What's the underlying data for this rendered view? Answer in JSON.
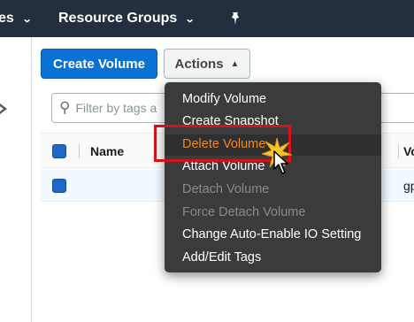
{
  "topnav": {
    "services_label": "es",
    "resource_groups_label": "Resource Groups",
    "pin_icon": "pin-icon"
  },
  "toolbar": {
    "create_label": "Create Volume",
    "actions_label": "Actions"
  },
  "filter": {
    "placeholder": "Filter by tags a"
  },
  "table": {
    "columns": [
      "Name",
      "Vo"
    ],
    "rows": [
      {
        "name": "",
        "volume_type": "gp"
      }
    ]
  },
  "menu": {
    "items": [
      {
        "label": "Modify Volume",
        "enabled": true
      },
      {
        "label": "Create Snapshot",
        "enabled": true
      },
      {
        "label": "Delete Volume",
        "enabled": true,
        "highlighted": true
      },
      {
        "label": "Attach Volume",
        "enabled": true
      },
      {
        "label": "Detach Volume",
        "enabled": false
      },
      {
        "label": "Force Detach Volume",
        "enabled": false
      },
      {
        "label": "Change Auto-Enable IO Setting",
        "enabled": true
      },
      {
        "label": "Add/Edit Tags",
        "enabled": true
      }
    ]
  },
  "colors": {
    "nav_bg": "#232f3e",
    "primary": "#0972d3",
    "menu_bg": "#3b3b3b",
    "highlight_text": "#f0891f",
    "annotation_red": "#d5121b"
  }
}
